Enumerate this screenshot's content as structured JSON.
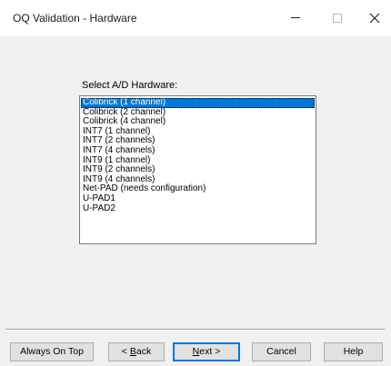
{
  "window": {
    "title": "OQ Validation - Hardware"
  },
  "titlebar_icons": {
    "minimize": "minimize-icon",
    "maximize": "maximize-icon",
    "close": "close-icon"
  },
  "hardware": {
    "prompt": "Select A/D Hardware:",
    "selected_index": 0,
    "options": [
      "Colibrick (1 channel)",
      "Colibrick (2 channel)",
      "Colibrick (4 channel)",
      "INT7 (1 channel)",
      "INT7 (2 channels)",
      "INT7 (4 channels)",
      "INT9 (1 channel)",
      "INT9 (2 channels)",
      "INT9 (4 channels)",
      "Net-PAD (needs configuration)",
      "U-PAD1",
      "U-PAD2"
    ]
  },
  "buttons": {
    "always_on_top": "Always On Top",
    "back_prefix": "< ",
    "back_mnemonic": "B",
    "back_rest": "ack",
    "next_mnemonic": "N",
    "next_rest": "ext >",
    "cancel": "Cancel",
    "help": "Help"
  },
  "colors": {
    "selection": "#0078d7",
    "default_button_border": "#0078d7",
    "window_background": "#f0f0f0"
  }
}
